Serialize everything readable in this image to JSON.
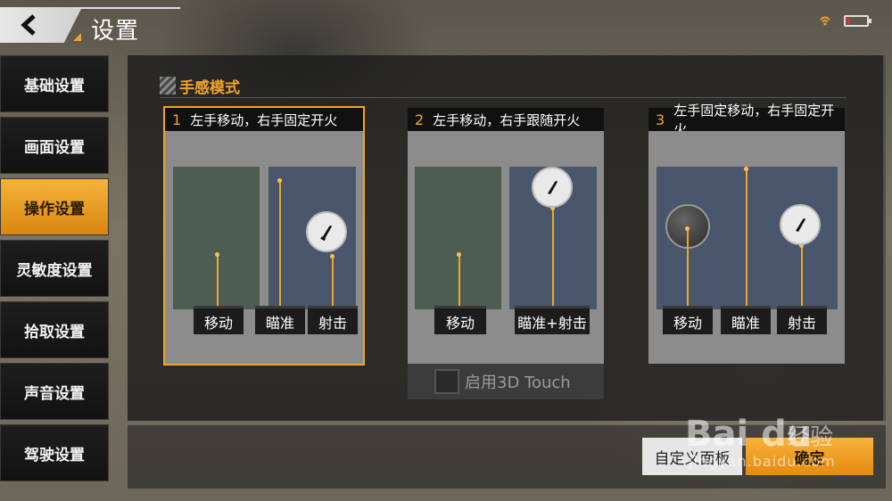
{
  "header": {
    "title": "设置",
    "back_icon": "back-arrow-icon"
  },
  "status": {
    "wifi_icon": "wifi-icon",
    "battery_icon": "battery-low-icon",
    "battery_level": 0.15
  },
  "sidebar": {
    "items": [
      {
        "label": "基础设置",
        "active": false
      },
      {
        "label": "画面设置",
        "active": false
      },
      {
        "label": "操作设置",
        "active": true
      },
      {
        "label": "灵敏度设置",
        "active": false
      },
      {
        "label": "拾取设置",
        "active": false
      },
      {
        "label": "声音设置",
        "active": false
      },
      {
        "label": "驾驶设置",
        "active": false
      }
    ]
  },
  "section": {
    "title": "手感模式"
  },
  "modes": [
    {
      "number": "1",
      "title": "左手移动，右手固定开火",
      "selected": true,
      "tags": [
        "移动",
        "瞄准",
        "射击"
      ]
    },
    {
      "number": "2",
      "title": "左手移动，右手跟随开火",
      "selected": false,
      "tags": [
        "移动",
        "瞄准+射击"
      ]
    },
    {
      "number": "3",
      "title": "左手固定移动，右手固定开火",
      "selected": false,
      "tags": [
        "移动",
        "瞄准",
        "射击"
      ]
    }
  ],
  "touch3d": {
    "label": "启用3D Touch",
    "checked": false
  },
  "buttons": {
    "custom": "自定义面板",
    "confirm": "确定"
  },
  "watermark": {
    "logo": "Bai du",
    "jingyan": "经验",
    "url": "jingyan.baidu.com"
  },
  "colors": {
    "accent": "#f0a528",
    "zone_green": "#4e5d52",
    "zone_blue": "#4a566b"
  }
}
